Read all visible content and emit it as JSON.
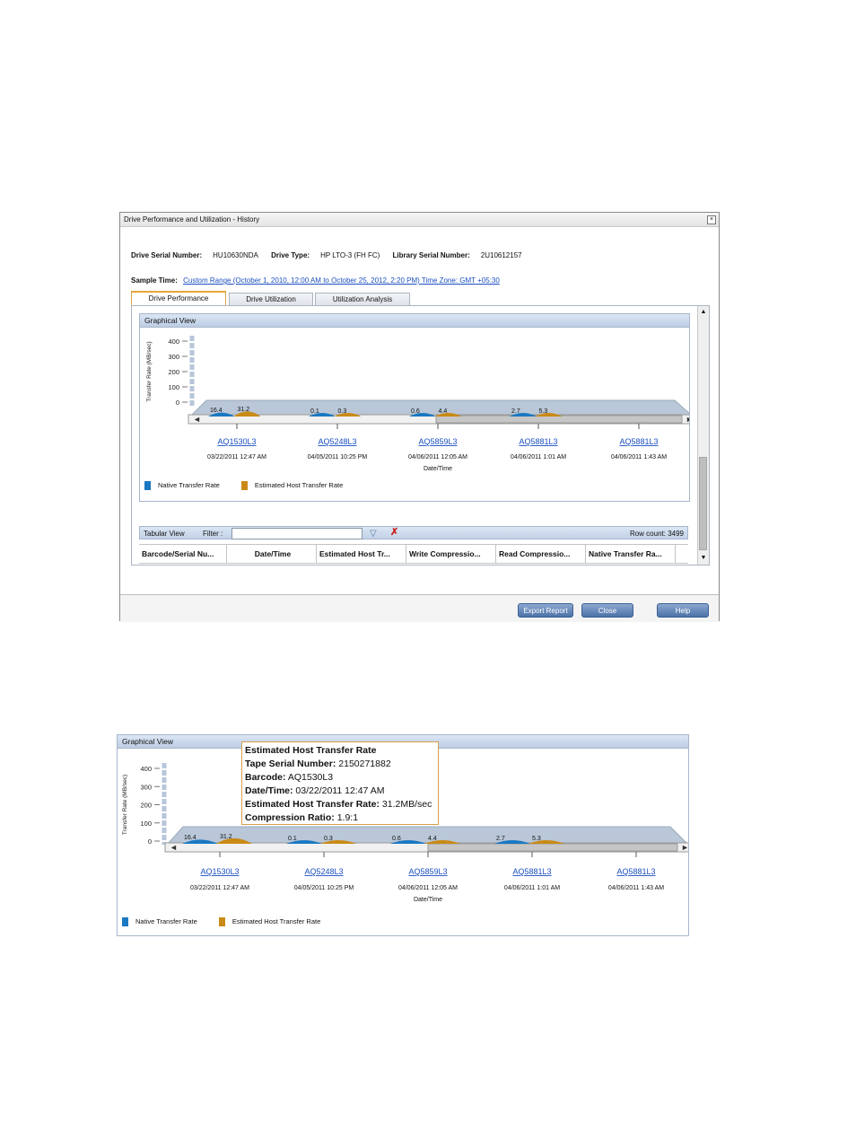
{
  "dialog": {
    "title": "Drive Performance and Utilization - History",
    "close_icon": "×",
    "drive_serial_label": "Drive Serial Number:",
    "drive_serial_value": "HU10630NDA",
    "drive_type_label": "Drive Type:",
    "drive_type_value": "HP LTO-3 (FH FC)",
    "library_serial_label": "Library Serial Number:",
    "library_serial_value": "2U10612157",
    "sample_time_label": "Sample Time:",
    "sample_time_value": "Custom Range (October 1, 2010, 12:00 AM to October 25, 2012, 2:20 PM) Time Zone: GMT +05:30",
    "tabs": [
      {
        "label": "Drive Performance",
        "active": true
      },
      {
        "label": "Drive Utilization",
        "active": false
      },
      {
        "label": "Utilization Analysis",
        "active": false
      }
    ],
    "buttons": {
      "export": "Export Report",
      "close": "Close",
      "help": "Help"
    }
  },
  "graph": {
    "title": "Graphical View",
    "legend": [
      {
        "label": "Native Transfer Rate",
        "color": "#1a78c2"
      },
      {
        "label": "Estimated Host Transfer Rate",
        "color": "#c98a16"
      }
    ]
  },
  "chart_data": {
    "type": "bar",
    "ylabel": "Transfer Rate (MB/sec)",
    "xlabel": "Date/Time",
    "ylim": [
      0,
      400
    ],
    "yticks": [
      400,
      300,
      200,
      100,
      0
    ],
    "categories": [
      {
        "barcode": "AQ1530L3",
        "datetime": "03/22/2011 12:47 AM"
      },
      {
        "barcode": "AQ5248L3",
        "datetime": "04/05/2011 10:25 PM"
      },
      {
        "barcode": "AQ5859L3",
        "datetime": "04/06/2011 12:05 AM"
      },
      {
        "barcode": "AQ5881L3",
        "datetime": "04/06/2011 1:01 AM"
      },
      {
        "barcode": "AQ5881L3",
        "datetime": "04/06/2011 1:43 AM"
      }
    ],
    "series": [
      {
        "name": "Native Transfer Rate",
        "values": [
          16.4,
          0.1,
          0.6,
          2.7,
          null
        ],
        "labels": [
          "16.4",
          "0.1",
          "0.6",
          "2.7"
        ]
      },
      {
        "name": "Estimated Host Transfer Rate",
        "values": [
          31.2,
          0.3,
          4.4,
          5.3,
          null
        ],
        "labels": [
          "31.2",
          "0.3",
          "4.4",
          "5.3"
        ]
      }
    ]
  },
  "tabular": {
    "title": "Tabular View",
    "filter_label": "Filter :",
    "filter_value": "",
    "row_count": "Row count: 3499",
    "columns": [
      "Barcode/Serial Nu...",
      "Date/Time",
      "Estimated Host Tr...",
      "Write Compressio...",
      "Read Compressio...",
      "Native Transfer Ra..."
    ]
  },
  "tooltip": {
    "title": "Estimated Host Transfer Rate",
    "lines": [
      {
        "label": "Tape Serial Number:",
        "value": "2150271882"
      },
      {
        "label": "Barcode:",
        "value": "AQ1530L3"
      },
      {
        "label": "Date/Time:",
        "value": "03/22/2011 12:47 AM"
      },
      {
        "label": "Estimated Host Transfer Rate:",
        "value": "31.2MB/sec"
      },
      {
        "label": "Compression Ratio:",
        "value": "1.9:1"
      }
    ]
  }
}
